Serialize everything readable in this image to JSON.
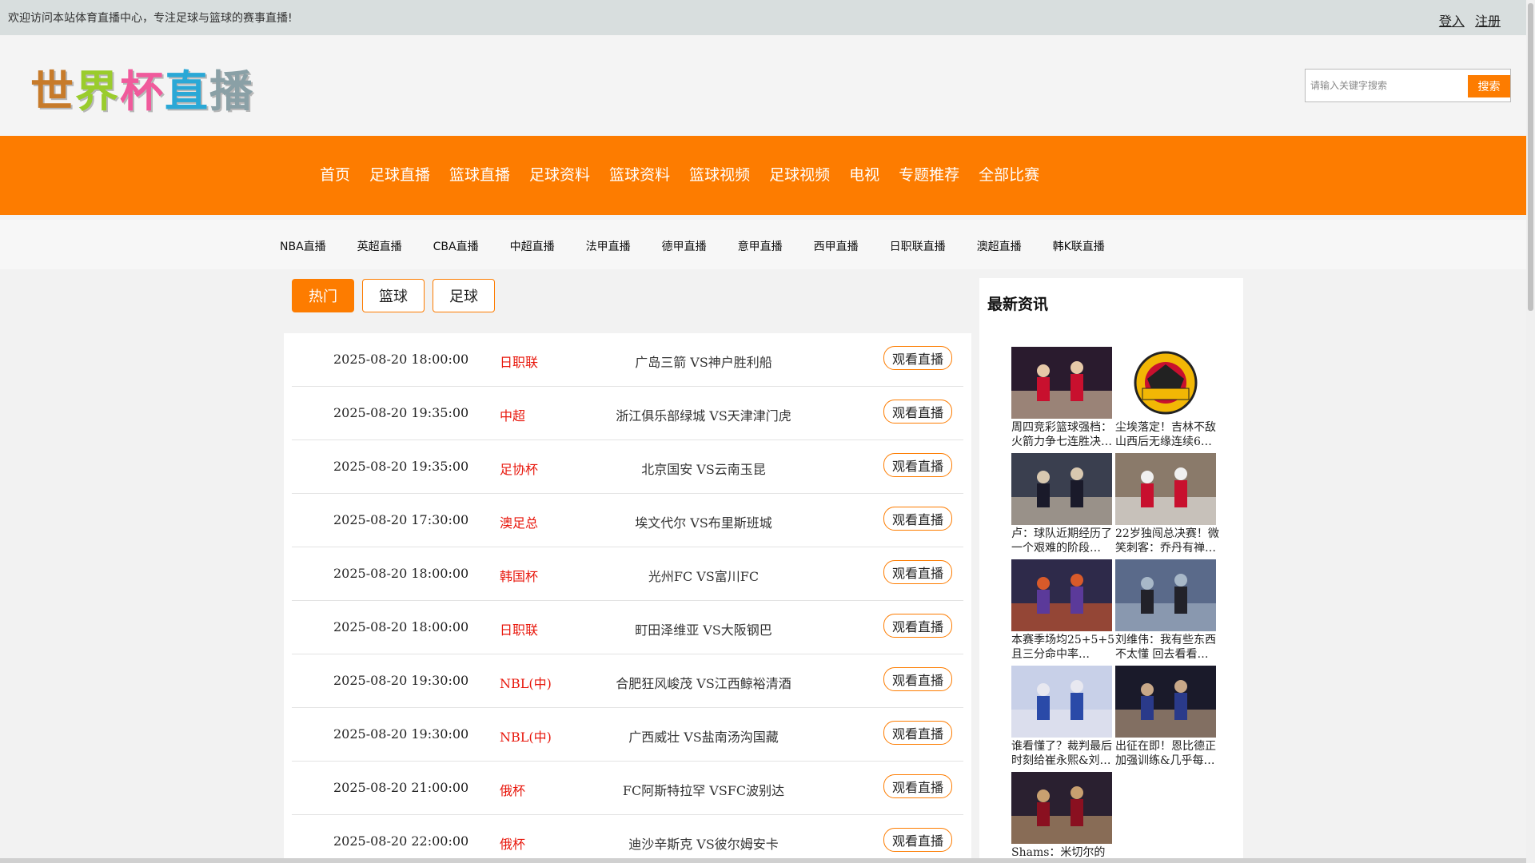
{
  "topbar": {
    "welcome": "欢迎访问本站体育直播中心，专注足球与篮球的赛事直播!",
    "login": "登入",
    "register": "注册"
  },
  "logo": {
    "chars": [
      "世",
      "界",
      "杯",
      "直",
      "播"
    ]
  },
  "search": {
    "placeholder": "请输入关键字搜索",
    "button": "搜索"
  },
  "main_nav": [
    "首页",
    "足球直播",
    "篮球直播",
    "足球资料",
    "篮球资料",
    "篮球视频",
    "足球视频",
    "电视",
    "专题推荐",
    "全部比赛"
  ],
  "sub_nav": [
    "NBA直播",
    "英超直播",
    "CBA直播",
    "中超直播",
    "法甲直播",
    "德甲直播",
    "意甲直播",
    "西甲直播",
    "日职联直播",
    "澳超直播",
    "韩K联直播"
  ],
  "tabs": [
    {
      "label": "热门",
      "active": true
    },
    {
      "label": "篮球",
      "active": false
    },
    {
      "label": "足球",
      "active": false
    }
  ],
  "matches": [
    {
      "time": "2025-08-20 18:00:00",
      "league": "日职联",
      "teams": "广岛三箭 VS神户胜利船",
      "action": "观看直播"
    },
    {
      "time": "2025-08-20 19:35:00",
      "league": "中超",
      "teams": "浙江俱乐部绿城 VS天津津门虎",
      "action": "观看直播"
    },
    {
      "time": "2025-08-20 19:35:00",
      "league": "足协杯",
      "teams": "北京国安 VS云南玉昆",
      "action": "观看直播"
    },
    {
      "time": "2025-08-20 17:30:00",
      "league": "澳足总",
      "teams": "埃文代尔 VS布里斯班城",
      "action": "观看直播"
    },
    {
      "time": "2025-08-20 18:00:00",
      "league": "韩国杯",
      "teams": "光州FC VS富川FC",
      "action": "观看直播"
    },
    {
      "time": "2025-08-20 18:00:00",
      "league": "日职联",
      "teams": "町田泽维亚 VS大阪钢巴",
      "action": "观看直播"
    },
    {
      "time": "2025-08-20 19:30:00",
      "league": "NBL(中)",
      "teams": "合肥狂风峻茂 VS江西鲸裕清酒",
      "action": "观看直播"
    },
    {
      "time": "2025-08-20 19:30:00",
      "league": "NBL(中)",
      "teams": "广西威壮 VS盐南汤沟国藏",
      "action": "观看直播"
    },
    {
      "time": "2025-08-20 21:00:00",
      "league": "俄杯",
      "teams": "FC阿斯特拉罕 VSFC波别达",
      "action": "观看直播"
    },
    {
      "time": "2025-08-20 22:00:00",
      "league": "俄杯",
      "teams": "迪沙辛斯克 VS彼尔姆安卡",
      "action": "观看直播"
    }
  ],
  "news": {
    "title": "最新资讯",
    "items": [
      {
        "caption": "周四竞彩篮球强档：火箭力争七连胜决 …",
        "icon": "basketball-photo"
      },
      {
        "caption": "尘埃落定！吉林不敌山西后无缘连续6…",
        "icon": "team-logo"
      },
      {
        "caption": "卢：球队近期经历了一个艰难的阶段 但…",
        "icon": "basketball-photo"
      },
      {
        "caption": "22岁独闯总决赛！微笑刺客：乔丹有禅…",
        "icon": "basketball-photo"
      },
      {
        "caption": "本赛季场均25+5+5且三分命中率40+%…",
        "icon": "basketball-photo"
      },
      {
        "caption": "刘维伟：我有些东西不太懂 回去看看联…",
        "icon": "basketball-photo"
      },
      {
        "caption": "谁看懂了？裁判最后时刻给崔永熙&刘…",
        "icon": "basketball-photo"
      },
      {
        "caption": "出征在即！恩比德正加强训练&几乎每…",
        "icon": "basketball-photo"
      },
      {
        "caption": "Shams：米切尔的膝盖伤病已是近两…",
        "icon": "basketball-photo"
      }
    ]
  },
  "colors": {
    "accent": "#fd7c00",
    "league_red": "#e8170c"
  }
}
